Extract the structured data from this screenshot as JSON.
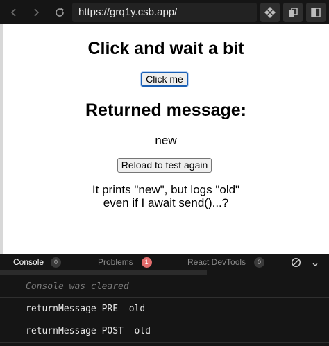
{
  "browser": {
    "url": "https://grq1y.csb.app/"
  },
  "page": {
    "heading": "Click and wait a bit",
    "click_button": "Click me",
    "returned_heading": "Returned message:",
    "returned_value": "new",
    "reload_button": "Reload to test again",
    "note_line1": "It prints \"new\", but logs \"old\"",
    "note_line2": "even if I await send()...?"
  },
  "devtools": {
    "tabs": [
      {
        "label": "Console",
        "badge": "0"
      },
      {
        "label": "Problems",
        "badge": "1"
      },
      {
        "label": "React DevTools",
        "badge": "0"
      }
    ],
    "console_lines": [
      "Console was cleared",
      "returnMessage PRE  old",
      "returnMessage POST  old"
    ]
  },
  "icons": {
    "back": "chevron-left-icon",
    "forward": "chevron-right-icon",
    "reload": "reload-icon",
    "codesandbox": "codesandbox-icon",
    "open-window": "open-window-icon",
    "clear": "clear-console-icon",
    "menu": "chevron-down-icon"
  },
  "colors": {
    "badge_problems": "#e26d6d",
    "focus_ring": "#1a5fb4"
  }
}
